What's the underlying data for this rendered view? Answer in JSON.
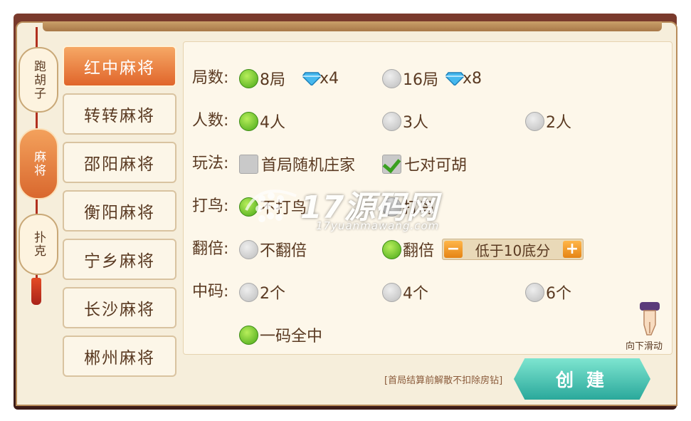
{
  "category_tabs": [
    {
      "label": "跑胡子",
      "selected": false
    },
    {
      "label": "麻将",
      "selected": true
    },
    {
      "label": "扑克",
      "selected": false
    }
  ],
  "games": [
    {
      "label": "红中麻将",
      "selected": true
    },
    {
      "label": "转转麻将",
      "selected": false
    },
    {
      "label": "邵阳麻将",
      "selected": false
    },
    {
      "label": "衡阳麻将",
      "selected": false
    },
    {
      "label": "宁乡麻将",
      "selected": false
    },
    {
      "label": "长沙麻将",
      "selected": false
    },
    {
      "label": "郴州麻将",
      "selected": false
    }
  ],
  "rounds": {
    "label": "局数:",
    "options": [
      {
        "text": "8局",
        "cost": "x4",
        "selected": true
      },
      {
        "text": "16局",
        "cost": "x8",
        "selected": false
      }
    ]
  },
  "players": {
    "label": "人数:",
    "options": [
      {
        "text": "4人",
        "selected": true
      },
      {
        "text": "3人",
        "selected": false
      },
      {
        "text": "2人",
        "selected": false
      }
    ]
  },
  "play": {
    "label": "玩法:",
    "options": [
      {
        "text": "首局随机庄家",
        "checked": false
      },
      {
        "text": "七对可胡",
        "checked": true
      }
    ]
  },
  "bird": {
    "label": "打鸟:",
    "options": [
      {
        "text": "不打鸟",
        "selected": true
      },
      {
        "text": "打鸟",
        "selected": false
      }
    ]
  },
  "double": {
    "label": "翻倍:",
    "options": [
      {
        "text": "不翻倍",
        "selected": false
      },
      {
        "text": "翻倍",
        "selected": true
      }
    ],
    "stepper_text": "低于10底分",
    "minus": "−",
    "plus": "+"
  },
  "zhongma": {
    "label": "中码:",
    "options": [
      {
        "text": "2个",
        "selected": false
      },
      {
        "text": "4个",
        "selected": false
      },
      {
        "text": "6个",
        "selected": false
      },
      {
        "text": "一码全中",
        "selected": true
      }
    ]
  },
  "hint": "[首局结算前解散不扣除房钻]",
  "create_label": "创建",
  "swipe_hint": "向下滑动",
  "watermark": {
    "main": "17源码网",
    "sub": "17yuanmawang.com"
  }
}
